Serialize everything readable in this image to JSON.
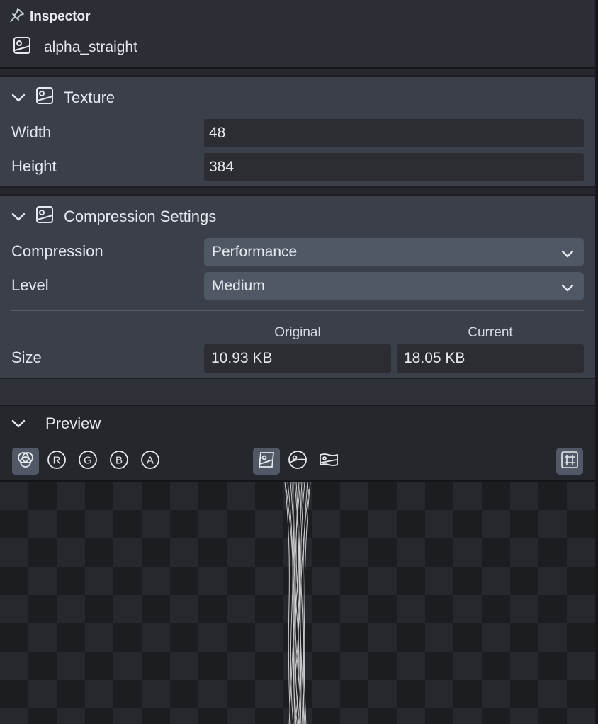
{
  "header": {
    "title": "Inspector",
    "asset_name": "alpha_straight"
  },
  "texture": {
    "title": "Texture",
    "width_label": "Width",
    "width_value": "48",
    "height_label": "Height",
    "height_value": "384"
  },
  "compression": {
    "title": "Compression Settings",
    "compression_label": "Compression",
    "compression_value": "Performance",
    "level_label": "Level",
    "level_value": "Medium",
    "size_label": "Size",
    "original_header": "Original",
    "current_header": "Current",
    "original_size": "10.93 KB",
    "current_size": "18.05 KB"
  },
  "preview": {
    "title": "Preview",
    "channels": [
      "R",
      "G",
      "B",
      "A"
    ],
    "icons": [
      "rgb-channels-icon",
      "r-channel-icon",
      "g-channel-icon",
      "b-channel-icon",
      "a-channel-icon",
      "texture-view-icon",
      "sphere-view-icon",
      "plane-view-icon",
      "grid-toggle-icon"
    ]
  },
  "colors": {
    "panel_bg": "#3a3f49",
    "field_bg": "#2b2d33",
    "select_bg": "#505866",
    "active_btn": "#515966"
  }
}
